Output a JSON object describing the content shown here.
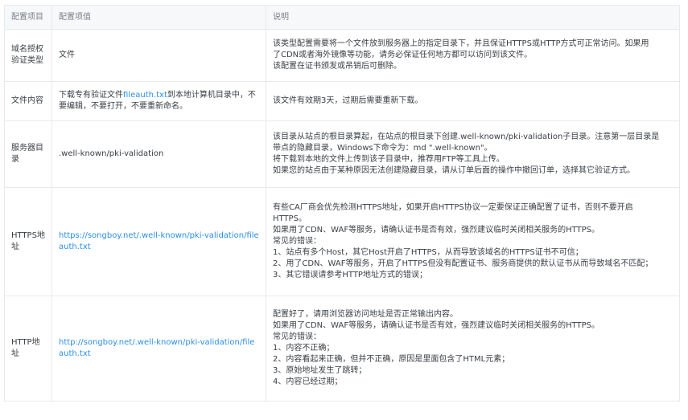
{
  "headers": [
    "配置项目",
    "配置项值",
    "说明"
  ],
  "rows": [
    {
      "item": "域名授权验证类型",
      "value_parts": [
        "文件"
      ],
      "desc": [
        "该类型配置需要将一个文件放到服务器上的指定目录下，并且保证HTTPS或HTTP方式可正常访问。如果用",
        "了CDN或者海外镜像等功能，请务必保证任何地方都可以访问到该文件。",
        "该配置在证书颁发或吊销后可删除。"
      ]
    },
    {
      "item": "文件内容",
      "value_parts": [
        "下载专有验证文件",
        "fileauth.txt",
        "到本地计算机目录中，不要编辑，不要打开，不要重新命名。"
      ],
      "desc": [
        "该文件有效期3天，过期后需要重新下载。"
      ]
    },
    {
      "item": "服务器目录",
      "value_parts": [
        ".well-known/pki-validation"
      ],
      "desc": [
        "该目录从站点的根目录算起，在站点的根目录下创建.well-known/pki-validation子目录。注意第一层目录是",
        "带点的隐藏目录，Windows下命令为：md \".well-known\"。",
        "将下载到本地的文件上传到该子目录中，推荐用FTP等工具上传。",
        "如果您的站点由于某种原因无法创建隐藏目录，请从订单后面的操作中撤回订单，选择其它验证方式。"
      ]
    },
    {
      "item": "HTTPS地址",
      "value_link": "https://songboy.net/.well-known/pki-validation/fileauth.txt",
      "desc": [
        "有些CA厂商会优先检测HTTPS地址，如果开启HTTPS协议一定要保证正确配置了证书，否则不要开启",
        "HTTPS。",
        "如果用了CDN、WAF等服务，请确认证书是否有效，强烈建议临时关闭相关服务的HTTPS。",
        "常见的错误：",
        "1、站点有多个Host，其它Host开启了HTTPS，从而导致该域名的HTTPS证书不可信；",
        "2、用了CDN、WAF等服务，开启了HTTPS但没有配置证书、服务商提供的默认证书从而导致域名不匹配；",
        "3、其它错误请参考HTTP地址方式的错误；"
      ]
    },
    {
      "item": "HTTP地址",
      "value_link": "http://songboy.net/.well-known/pki-validation/fileauth.txt",
      "desc": [
        "配置好了，请用浏览器访问地址是否正常输出内容。",
        "如果用了CDN、WAF等服务，请确认证书是否有效，强烈建议临时关闭相关服务的HTTPS。",
        "常见的错误：",
        "1、内容不正确；",
        "2、内容看起来正确，但并不正确，原因是里面包含了HTML元素；",
        "3、原始地址发生了跳转；",
        "4、内容已经过期；"
      ]
    }
  ],
  "colors": {
    "link": "#2a8ee8",
    "border": "#e6e9ee",
    "header_bg": "#f7f8fa"
  }
}
